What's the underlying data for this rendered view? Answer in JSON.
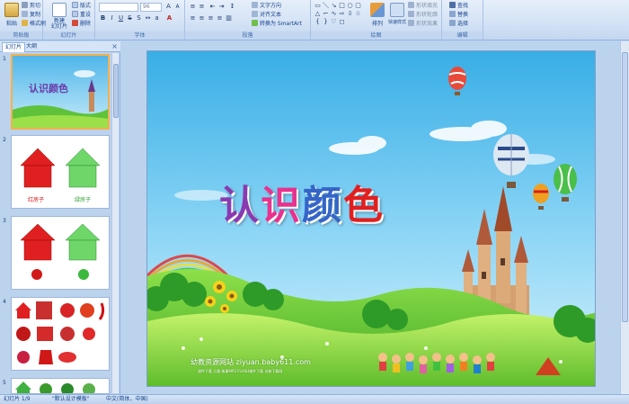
{
  "ribbon": {
    "clipboard": {
      "label": "剪贴板",
      "paste": "粘贴",
      "cut": "剪切",
      "copy": "复制",
      "format_painter": "格式刷"
    },
    "slides": {
      "label": "幻灯片",
      "new_slide": "新建\n幻灯片",
      "layout": "版式",
      "reset": "重设",
      "delete": "删除"
    },
    "font": {
      "label": "字体",
      "font_size": "96"
    },
    "paragraph": {
      "label": "段落",
      "text_direction": "文字方向",
      "align_text": "对齐文本",
      "convert_smartart": "转换为 SmartArt"
    },
    "drawing": {
      "label": "绘图",
      "arrange": "排列",
      "quick_styles": "快速样式",
      "shape_fill": "形状填充",
      "shape_outline": "形状轮廓",
      "shape_effects": "形状效果"
    },
    "editing": {
      "label": "编辑",
      "find": "查找",
      "replace": "替换",
      "select": "选择"
    }
  },
  "pane": {
    "tabs": [
      "幻灯片",
      "大纲"
    ],
    "close": "×",
    "thumbs": [
      {
        "num": "1",
        "title": "认识颜色"
      },
      {
        "num": "2",
        "caption_red": "红房子",
        "caption_green": "绿房子"
      },
      {
        "num": "3"
      },
      {
        "num": "4"
      },
      {
        "num": "5"
      }
    ]
  },
  "slide": {
    "title_chars": [
      "认",
      "识",
      "颜",
      "色"
    ],
    "title_colors": [
      "#8a3ab0",
      "#e8328e",
      "#3565c8",
      "#e02020"
    ],
    "footer": "幼教资源网站  ziyuan.baby611.com",
    "footer_sub": "课件下载   儿歌   故事MP3   FLASH课件下载   试卷下载网"
  },
  "status": {
    "slide_info": "幻灯片 1/9",
    "theme": "\"默认设计模板\"",
    "lang": "中文(简体，中国)"
  }
}
